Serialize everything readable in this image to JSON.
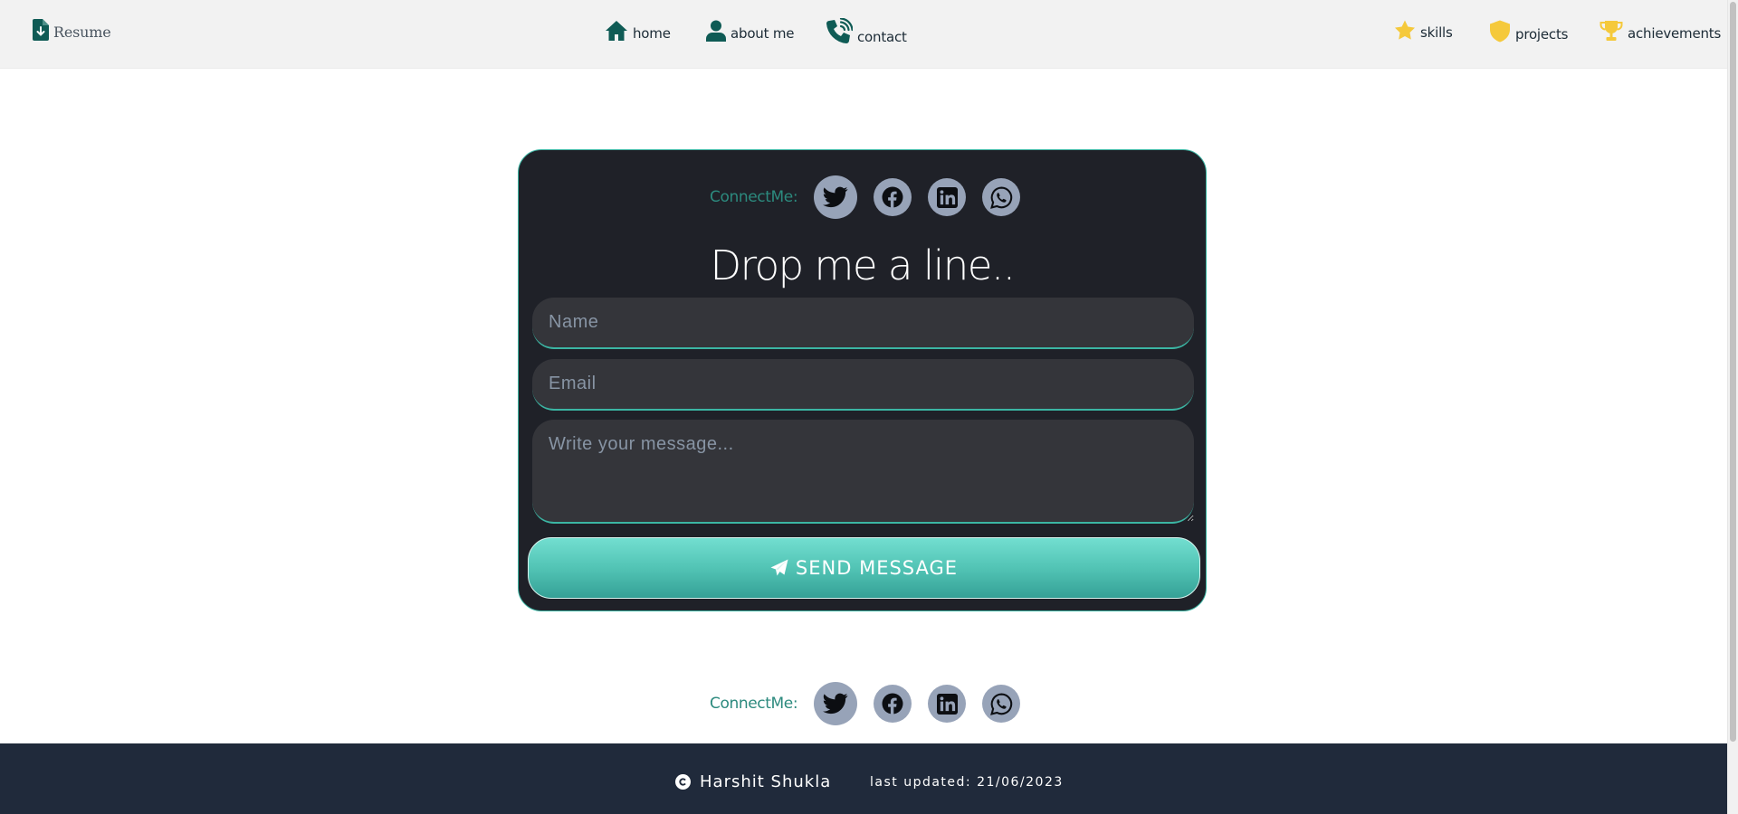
{
  "nav": {
    "resume_label": "Resume",
    "home_label": "home",
    "about_label": "about me",
    "contact_label": "contact",
    "skills_label": "skills",
    "projects_label": "projects",
    "achievements_label": "achievements"
  },
  "contact_card": {
    "connect_label": "ConnectMe:",
    "socials": [
      "twitter-icon",
      "facebook-icon",
      "linkedin-icon",
      "whatsapp-icon"
    ],
    "title": "Drop me a line..",
    "name_placeholder": "Name",
    "email_placeholder": "Email",
    "message_placeholder": "Write your message...",
    "send_label": "SEND MESSAGE"
  },
  "page_connect": {
    "connect_label": "ConnectMe:"
  },
  "footer": {
    "author": "Harshit Shukla",
    "last_updated": "last updated: 21/06/2023"
  },
  "colors": {
    "accent": "#3bb5a3",
    "nav_icon": "#0f5b55",
    "yellow_icon": "#f5c93b",
    "card_bg": "#1f2128",
    "footer_bg": "#202a3b",
    "social_bg": "#97a3b8"
  }
}
